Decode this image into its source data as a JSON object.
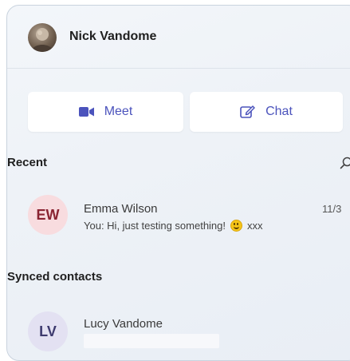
{
  "profile": {
    "name": "Nick Vandome",
    "avatar_icon": "user-photo"
  },
  "actions": {
    "meet_label": "Meet",
    "meet_icon": "video-camera-icon",
    "chat_label": "Chat",
    "chat_icon": "compose-icon",
    "accent_color": "#4b53bc"
  },
  "recent": {
    "label": "Recent",
    "search_icon": "search-icon",
    "items": [
      {
        "initials": "EW",
        "name": "Emma Wilson",
        "preview_prefix": "You: Hi, just testing something!",
        "preview_emoji": "smiley-emoji",
        "preview_suffix": "xxx",
        "date": "11/3"
      }
    ]
  },
  "synced": {
    "label": "Synced contacts",
    "items": [
      {
        "initials": "LV",
        "name": "Lucy Vandome"
      }
    ]
  }
}
